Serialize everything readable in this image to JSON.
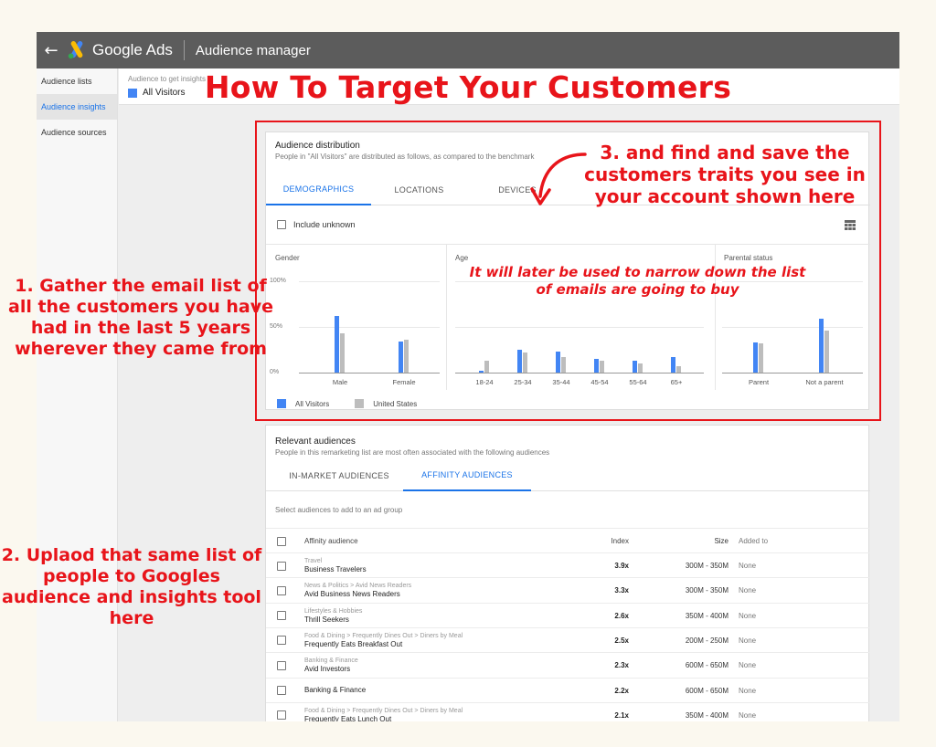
{
  "app": {
    "brand": "Google Ads",
    "section": "Audience manager"
  },
  "sidebar": {
    "items": [
      {
        "label": "Audience lists",
        "active": false
      },
      {
        "label": "Audience insights",
        "active": true
      },
      {
        "label": "Audience sources",
        "active": false
      }
    ]
  },
  "selector": {
    "label": "Audience to get insights",
    "value": "All Visitors"
  },
  "distribution": {
    "title": "Audience distribution",
    "subtitle": "People in \"All Visitors\" are distributed as follows, as compared to the benchmark",
    "tabs": [
      "DEMOGRAPHICS",
      "LOCATIONS",
      "DEVICES"
    ],
    "active_tab": "DEMOGRAPHICS",
    "include_unknown": "Include unknown",
    "legend": [
      "All Visitors",
      "United States"
    ]
  },
  "chart_data": [
    {
      "type": "bar",
      "title": "Gender",
      "ylim": [
        0,
        100
      ],
      "yticks": [
        "100%",
        "50%",
        "0%"
      ],
      "categories": [
        "Male",
        "Female"
      ],
      "series": [
        {
          "name": "All Visitors",
          "values": [
            62,
            34
          ]
        },
        {
          "name": "United States",
          "values": [
            43,
            36
          ]
        }
      ]
    },
    {
      "type": "bar",
      "title": "Age",
      "ylim": [
        0,
        100
      ],
      "categories": [
        "18-24",
        "25-34",
        "35-44",
        "45-54",
        "55-64",
        "65+"
      ],
      "series": [
        {
          "name": "All Visitors",
          "values": [
            2,
            25,
            23,
            15,
            13,
            17
          ]
        },
        {
          "name": "United States",
          "values": [
            13,
            22,
            17,
            13,
            10,
            7
          ]
        }
      ]
    },
    {
      "type": "bar",
      "title": "Parental status",
      "ylim": [
        0,
        100
      ],
      "categories": [
        "Parent",
        "Not a parent"
      ],
      "series": [
        {
          "name": "All Visitors",
          "values": [
            33,
            59
          ]
        },
        {
          "name": "United States",
          "values": [
            32,
            46
          ]
        }
      ]
    }
  ],
  "relevant": {
    "title": "Relevant audiences",
    "subtitle": "People in this remarketing list are most often associated with the following audiences",
    "tabs": [
      "IN-MARKET AUDIENCES",
      "AFFINITY AUDIENCES"
    ],
    "active_tab": "AFFINITY AUDIENCES",
    "hint": "Select audiences to add to an ad group",
    "columns": {
      "audience": "Affinity audience",
      "index": "Index",
      "size": "Size",
      "added": "Added to"
    },
    "rows": [
      {
        "category": "Travel",
        "name": "Business Travelers",
        "index": "3.9x",
        "size": "300M - 350M",
        "added": "None"
      },
      {
        "category": "News & Politics > Avid News Readers",
        "name": "Avid Business News Readers",
        "index": "3.3x",
        "size": "300M - 350M",
        "added": "None"
      },
      {
        "category": "Lifestyles & Hobbies",
        "name": "Thrill Seekers",
        "index": "2.6x",
        "size": "350M - 400M",
        "added": "None"
      },
      {
        "category": "Food & Dining > Frequently Dines Out > Diners by Meal",
        "name": "Frequently Eats Breakfast Out",
        "index": "2.5x",
        "size": "200M - 250M",
        "added": "None"
      },
      {
        "category": "Banking & Finance",
        "name": "Avid Investors",
        "index": "2.3x",
        "size": "600M - 650M",
        "added": "None"
      },
      {
        "category": "",
        "name": "Banking & Finance",
        "index": "2.2x",
        "size": "600M - 650M",
        "added": "None"
      },
      {
        "category": "Food & Dining > Frequently Dines Out > Diners by Meal",
        "name": "Frequently Eats Lunch Out",
        "index": "2.1x",
        "size": "350M - 400M",
        "added": "None"
      }
    ]
  },
  "annotations": {
    "title": "How To Target Your Customers",
    "step1": "1. Gather the email list of all the customers you have had in the last 5 years wherever they came from",
    "step2": "2. Uplaod that same list of people to Googles audience and insights tool here",
    "step3": "3. and find and save the customers traits you see in your account shown here",
    "note": "It will later be used to narrow down the list of emails are going to buy"
  },
  "colors": {
    "annotation_red": "#e8141a",
    "series_primary": "#4285f4",
    "series_benchmark": "#bdbdbd",
    "accent": "#1a73e8",
    "topbar": "#5c5c5c"
  }
}
